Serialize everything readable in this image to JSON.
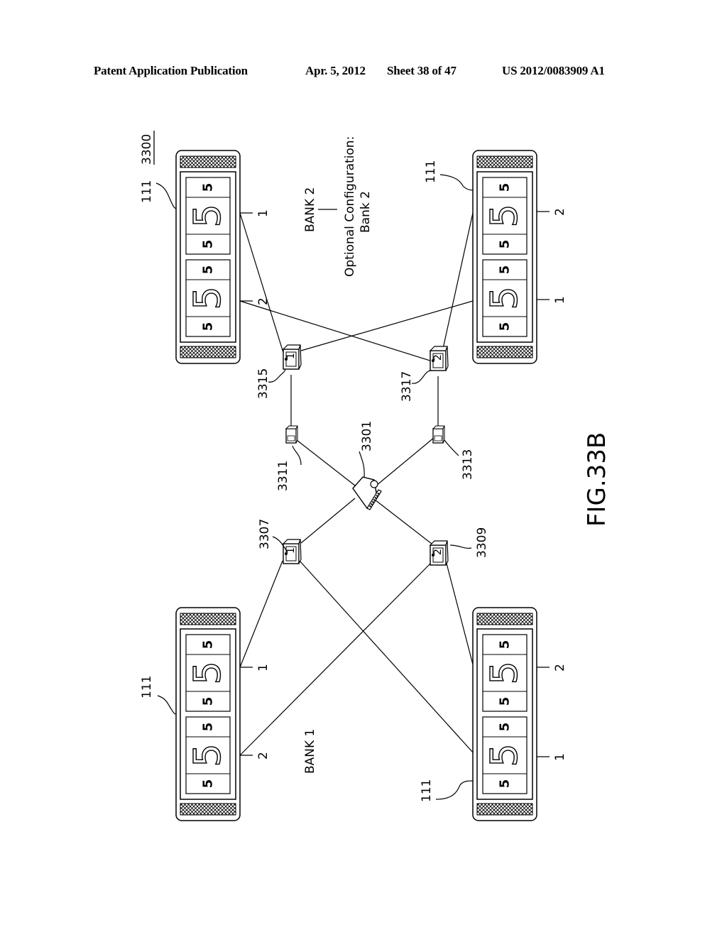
{
  "header": {
    "publication": "Patent Application Publication",
    "date": "Apr. 5, 2012",
    "sheet": "Sheet 38 of 47",
    "number": "US 2012/0083909 A1"
  },
  "figure": {
    "id": "3300",
    "caption": "FIG.33B",
    "bank1_label": "BANK 1",
    "bank2_label": "BANK 2",
    "optional_config_line1": "Optional Configuration:",
    "optional_config_line2": "Bank 2",
    "components": {
      "server": "3301",
      "switch_bank1_a": "3307",
      "switch_bank1_b": "3309",
      "hub_a": "3311",
      "hub_b": "3313",
      "switch_bank2_a": "3315",
      "switch_bank2_b": "3317"
    },
    "machines": [
      {
        "ref": "111",
        "position": "top-left",
        "port_a": "1",
        "port_b": "2"
      },
      {
        "ref": "111",
        "position": "top-right",
        "port_a": "2",
        "port_b": "1"
      },
      {
        "ref": "111",
        "position": "bottom-left",
        "port_a": "1",
        "port_b": "2"
      },
      {
        "ref": "111",
        "position": "bottom-right",
        "port_a": "2",
        "port_b": "1"
      }
    ],
    "reel_symbol_small": "5",
    "reel_symbol_large": "5",
    "switch_marks": [
      "1",
      "2"
    ]
  }
}
